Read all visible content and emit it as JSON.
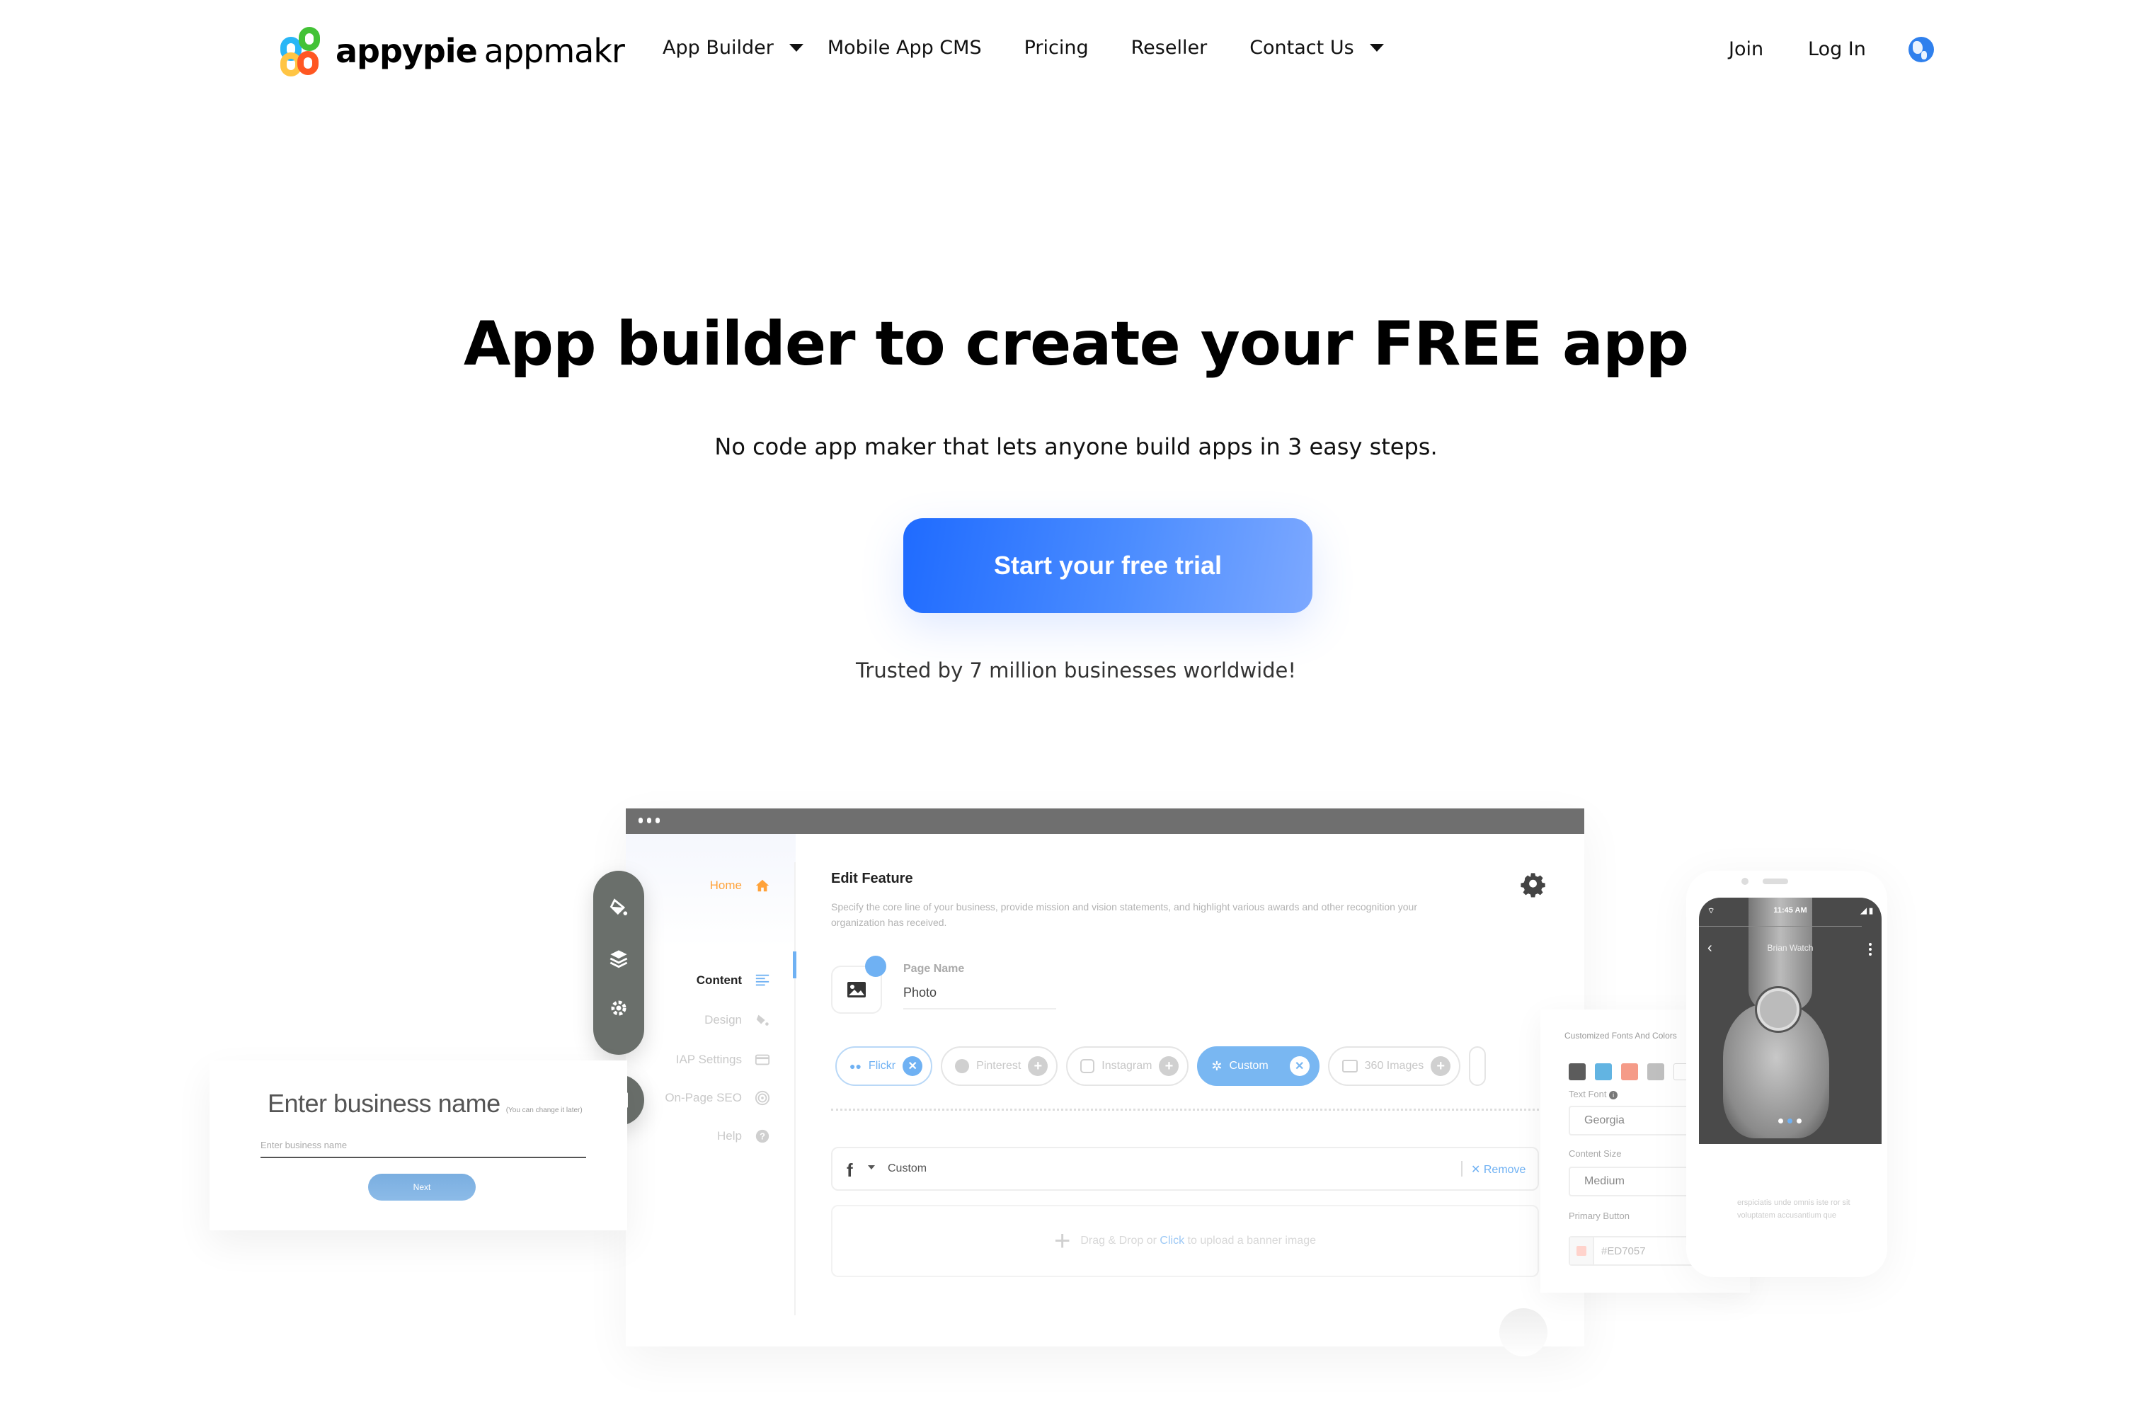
{
  "nav": {
    "brand": {
      "bold": "appypie",
      "light": "appmakr"
    },
    "links": [
      {
        "label": "App Builder",
        "has_dropdown": true
      },
      {
        "label": "Mobile App CMS",
        "has_dropdown": false
      },
      {
        "label": "Pricing",
        "has_dropdown": false
      },
      {
        "label": "Reseller",
        "has_dropdown": false
      },
      {
        "label": "Contact Us",
        "has_dropdown": true
      }
    ],
    "join": "Join",
    "login": "Log In",
    "language_icon": "globe-icon"
  },
  "hero": {
    "title": "App builder to create your FREE app",
    "subtitle": "No code app maker that lets anyone build apps in 3 easy steps.",
    "cta": "Start your free trial",
    "trusted": "Trusted by 7 million businesses worldwide!"
  },
  "colors": {
    "cta_start": "#1f6bff",
    "cta_end": "#7ca8ff",
    "accent_blue": "#6fb1f3",
    "home_orange": "#ffa23a",
    "toolbar_gray": "#6a6f6b"
  },
  "mockup": {
    "sidenav": {
      "home": "Home",
      "items": [
        {
          "label": "Content",
          "icon": "align-left-icon",
          "active": true
        },
        {
          "label": "Design",
          "icon": "paint-bucket-icon",
          "active": false
        },
        {
          "label": "IAP Settings",
          "icon": "credit-card-icon",
          "active": false
        },
        {
          "label": "On-Page SEO",
          "icon": "target-icon",
          "active": false
        },
        {
          "label": "Help",
          "icon": "help-icon",
          "active": false
        }
      ]
    },
    "editor": {
      "title": "Edit Feature",
      "description": "Specify the core line of your business, provide mission and vision statements, and highlight various awards and other recognition your organization has received.",
      "page_name_label": "Page Name",
      "page_name_value": "Photo",
      "chips": [
        {
          "label": "Flickr",
          "state": "added"
        },
        {
          "label": "Pinterest",
          "state": "available"
        },
        {
          "label": "Instagram",
          "state": "available"
        },
        {
          "label": "Custom",
          "state": "selected"
        },
        {
          "label": "360 Images",
          "state": "available"
        }
      ],
      "custom_row": {
        "label": "Custom",
        "remove": "Remove"
      },
      "upload": {
        "before": "Drag & Drop or ",
        "link": "Click",
        "after": " to upload a banner image"
      }
    },
    "business": {
      "title": "Enter business name",
      "hint": "(You can change it later)",
      "placeholder": "Enter business name",
      "next": "Next"
    },
    "customize": {
      "title": "Customized Fonts And Colors",
      "swatches": [
        "#5c5c5c",
        "#62b4e2",
        "#f59b88",
        "#bfbfbf",
        "#ffffff",
        "#ef5f57"
      ],
      "text_font_label": "Text Font",
      "text_font_value": "Georgia",
      "content_size_label": "Content Size",
      "content_size_value": "Medium",
      "primary_button_label": "Primary Button",
      "primary_button_value": "#ED7057"
    },
    "phone": {
      "time": "11:45 AM",
      "title": "Brian Watch",
      "body": "erspiciatis unde omnis iste ror sit voluptatem accusantium que",
      "pager_total": 3,
      "pager_active": 2
    }
  }
}
